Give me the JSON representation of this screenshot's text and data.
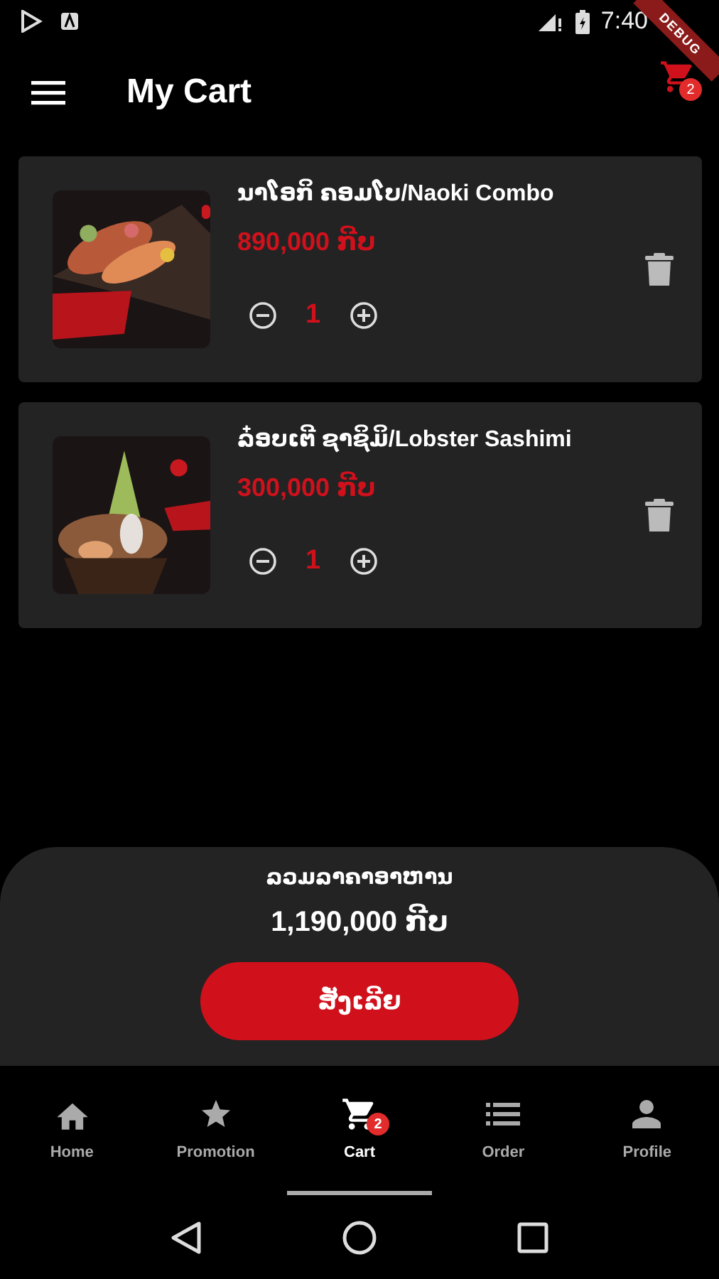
{
  "status_bar": {
    "time": "7:40"
  },
  "debug_banner": "DEBUG",
  "app_bar": {
    "title": "My Cart",
    "cart_badge": "2"
  },
  "cart_items": [
    {
      "name": "ນາໂອກິ ຄອມໂບ/Naoki Combo",
      "price": "890,000 ກີບ",
      "quantity": "1"
    },
    {
      "name": "ລ໋ອບເຕີ ຊາຊິມິ/Lobster Sashimi",
      "price": "300,000 ກີບ",
      "quantity": "1"
    }
  ],
  "summary": {
    "label": "ລວມລາຄາອາຫານ",
    "total": "1,190,000 ກີບ",
    "button": "ສັ່ງເລີຍ"
  },
  "bottom_nav": [
    {
      "label": "Home",
      "selected": false
    },
    {
      "label": "Promotion",
      "selected": false
    },
    {
      "label": "Cart",
      "selected": true,
      "badge": "2"
    },
    {
      "label": "Order",
      "selected": false
    },
    {
      "label": "Profile",
      "selected": false
    }
  ]
}
